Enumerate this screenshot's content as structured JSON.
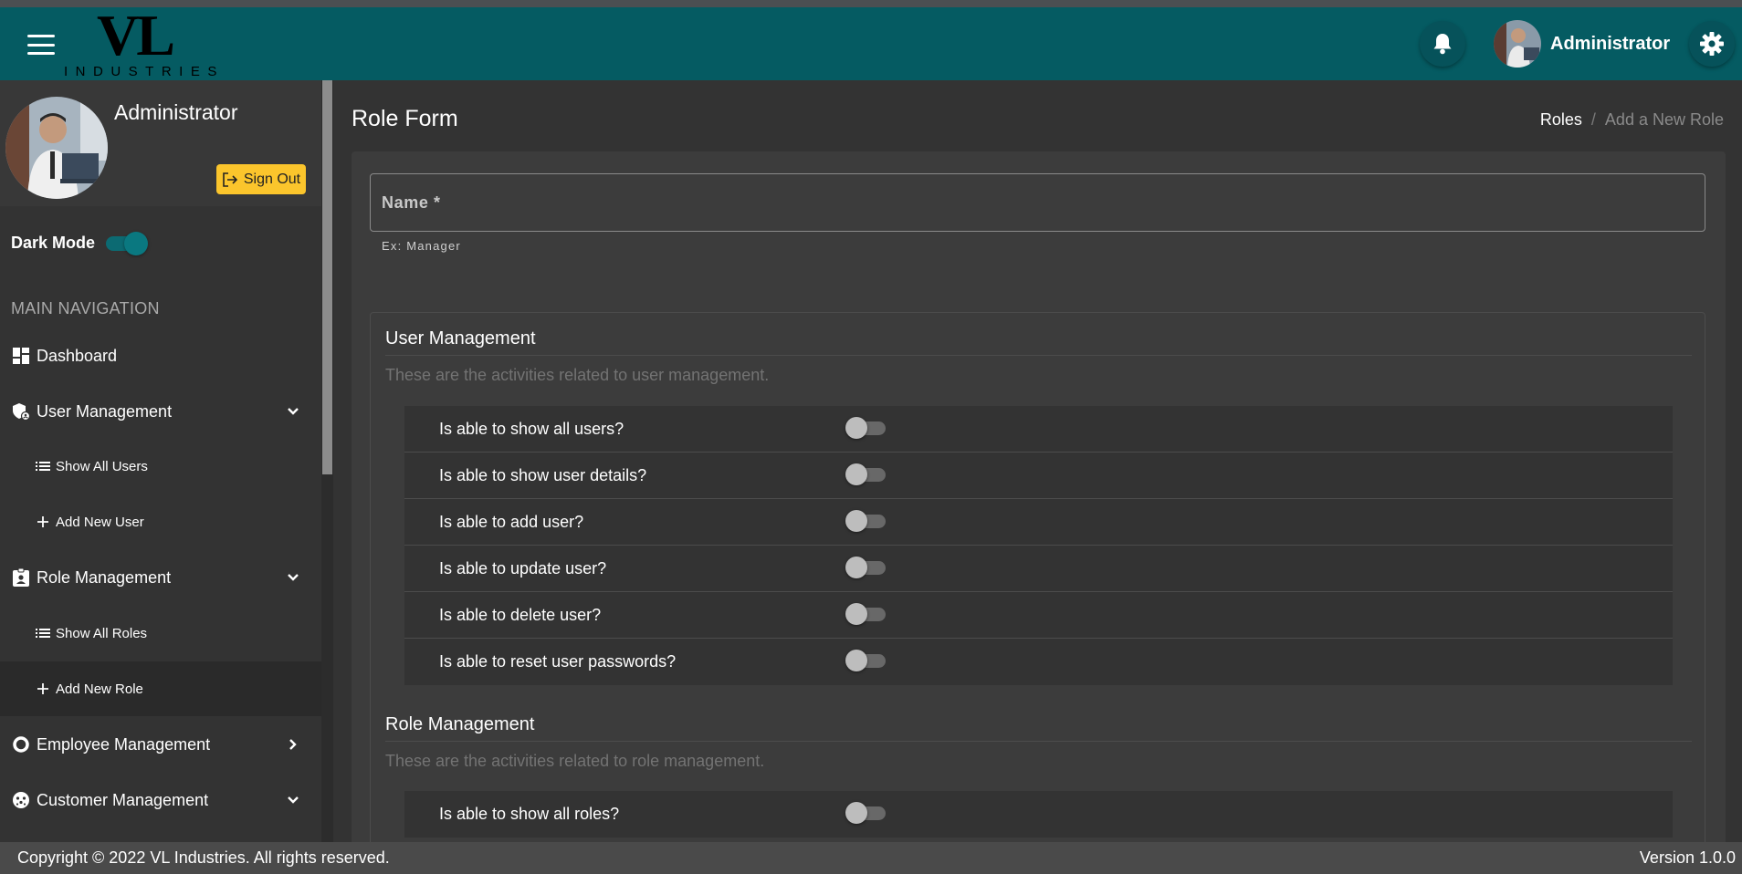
{
  "header": {
    "logo_main": "VL",
    "logo_sub": "INDUSTRIES",
    "user_name": "Administrator"
  },
  "sidebar": {
    "profile_name": "Administrator",
    "sign_out_label": "Sign Out",
    "dark_mode_label": "Dark Mode",
    "dark_mode_on": true,
    "nav_header": "MAIN NAVIGATION",
    "items": [
      {
        "label": "Dashboard",
        "icon": "dashboard-icon"
      },
      {
        "label": "User Management",
        "icon": "shield-user-icon",
        "chevron": "chevron-down-icon"
      },
      {
        "label": "Show All Users",
        "icon": "list-icon"
      },
      {
        "label": "Add New User",
        "icon": "plus-icon"
      },
      {
        "label": "Role Management",
        "icon": "badge-icon",
        "chevron": "chevron-down-icon"
      },
      {
        "label": "Show All Roles",
        "icon": "list-icon"
      },
      {
        "label": "Add New Role",
        "icon": "plus-icon",
        "active": true
      },
      {
        "label": "Employee Management",
        "icon": "ring-icon",
        "chevron": "chevron-right-icon"
      },
      {
        "label": "Customer Management",
        "icon": "face-icon",
        "chevron": "chevron-down-icon"
      }
    ]
  },
  "main": {
    "page_title": "Role Form",
    "breadcrumb": {
      "link": "Roles",
      "separator": "/",
      "current": "Add a New Role"
    },
    "name_field": {
      "placeholder": "Name *",
      "hint": "Ex: Manager",
      "value": ""
    },
    "sections": [
      {
        "title": "User Management",
        "description": "These are the activities related to user management.",
        "permissions": [
          {
            "label": "Is able to show all users?",
            "enabled": false
          },
          {
            "label": "Is able to show user details?",
            "enabled": false
          },
          {
            "label": "Is able to add user?",
            "enabled": false
          },
          {
            "label": "Is able to update user?",
            "enabled": false
          },
          {
            "label": "Is able to delete user?",
            "enabled": false
          },
          {
            "label": "Is able to reset user passwords?",
            "enabled": false
          }
        ]
      },
      {
        "title": "Role Management",
        "description": "These are the activities related to role management.",
        "permissions": [
          {
            "label": "Is able to show all roles?",
            "enabled": false
          }
        ]
      }
    ]
  },
  "footer": {
    "copyright": "Copyright © 2022 VL Industries. All rights reserved.",
    "version": "Version 1.0.0"
  },
  "colors": {
    "topbar": "#055b62",
    "accent": "#0a7880",
    "sign_out": "#fbc52c",
    "background": "#333333"
  }
}
